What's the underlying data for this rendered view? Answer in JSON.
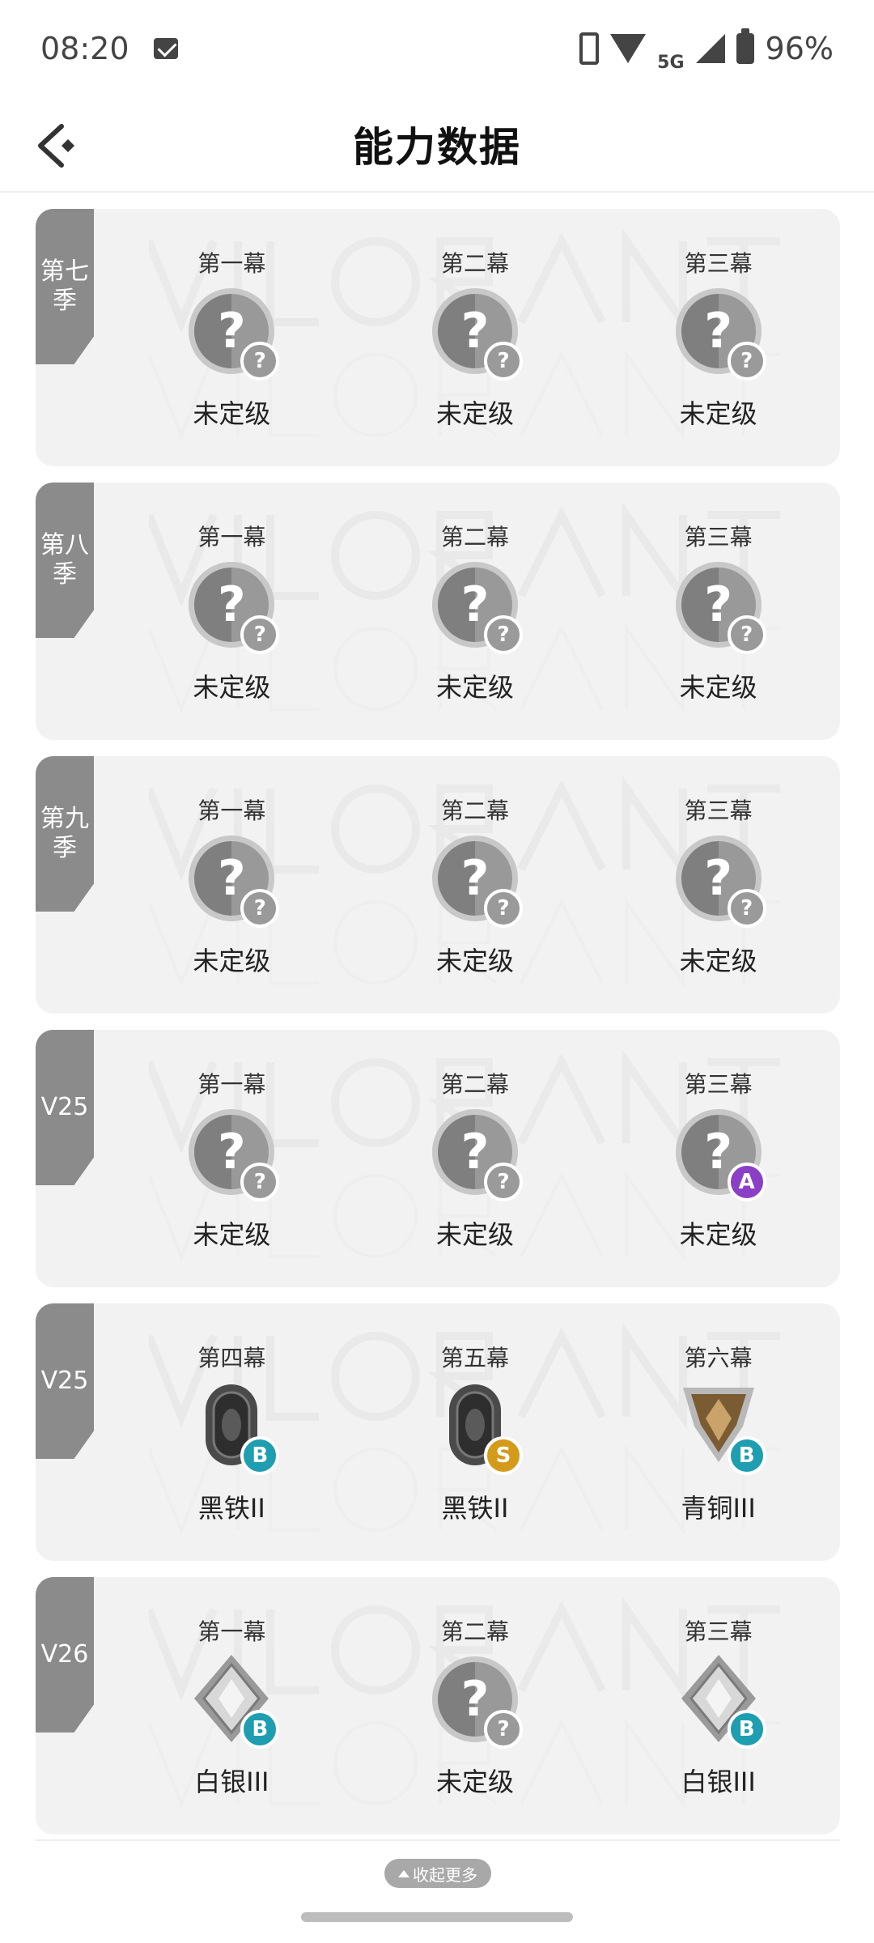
{
  "status_bar": {
    "time": "08:20",
    "network": "5G",
    "battery": "96%"
  },
  "header": {
    "title": "能力数据"
  },
  "seasons": [
    {
      "tag": "第七季",
      "acts": [
        {
          "title": "第一幕",
          "rank": "未定级",
          "icon": "unranked-icon",
          "badge": "?"
        },
        {
          "title": "第二幕",
          "rank": "未定级",
          "icon": "unranked-icon",
          "badge": "?"
        },
        {
          "title": "第三幕",
          "rank": "未定级",
          "icon": "unranked-icon",
          "badge": "?"
        }
      ]
    },
    {
      "tag": "第八季",
      "acts": [
        {
          "title": "第一幕",
          "rank": "未定级",
          "icon": "unranked-icon",
          "badge": "?"
        },
        {
          "title": "第二幕",
          "rank": "未定级",
          "icon": "unranked-icon",
          "badge": "?"
        },
        {
          "title": "第三幕",
          "rank": "未定级",
          "icon": "unranked-icon",
          "badge": "?"
        }
      ]
    },
    {
      "tag": "第九季",
      "acts": [
        {
          "title": "第一幕",
          "rank": "未定级",
          "icon": "unranked-icon",
          "badge": "?"
        },
        {
          "title": "第二幕",
          "rank": "未定级",
          "icon": "unranked-icon",
          "badge": "?"
        },
        {
          "title": "第三幕",
          "rank": "未定级",
          "icon": "unranked-icon",
          "badge": "?"
        }
      ]
    },
    {
      "tag": "V25",
      "acts": [
        {
          "title": "第一幕",
          "rank": "未定级",
          "icon": "unranked-icon",
          "badge": "?"
        },
        {
          "title": "第二幕",
          "rank": "未定级",
          "icon": "unranked-icon",
          "badge": "?"
        },
        {
          "title": "第三幕",
          "rank": "未定级",
          "icon": "unranked-icon",
          "badge": "A"
        }
      ]
    },
    {
      "tag": "V25",
      "acts": [
        {
          "title": "第四幕",
          "rank": "黑铁II",
          "icon": "iron-rank-icon",
          "badge": "B"
        },
        {
          "title": "第五幕",
          "rank": "黑铁II",
          "icon": "iron-rank-icon",
          "badge": "S"
        },
        {
          "title": "第六幕",
          "rank": "青铜III",
          "icon": "bronze-rank-icon",
          "badge": "B"
        }
      ]
    },
    {
      "tag": "V26",
      "acts": [
        {
          "title": "第一幕",
          "rank": "白银III",
          "icon": "silver-rank-icon",
          "badge": "B"
        },
        {
          "title": "第二幕",
          "rank": "未定级",
          "icon": "unranked-icon",
          "badge": "?"
        },
        {
          "title": "第三幕",
          "rank": "白银III",
          "icon": "silver-rank-icon",
          "badge": "B"
        }
      ]
    }
  ],
  "footer": {
    "collapse_label": "收起更多"
  },
  "colors": {
    "card_bg": "#f2f2f2",
    "tag_bg": "#8b8b8b",
    "badge_A": "#8b3fc7",
    "badge_B": "#1e9eb0",
    "badge_S": "#d49a1a",
    "badge_unknown": "#9a9a9a"
  }
}
